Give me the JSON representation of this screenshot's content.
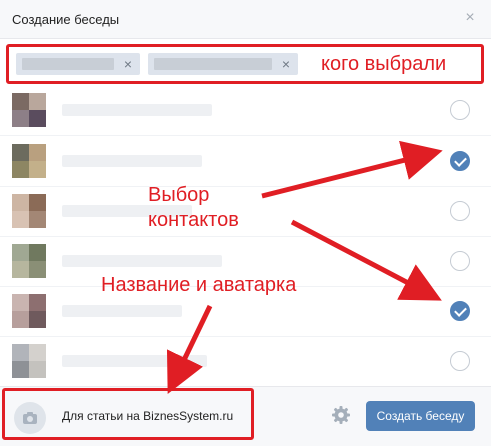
{
  "dialog": {
    "title": "Создание беседы",
    "close_icon": "×"
  },
  "selected": {
    "chips": [
      {
        "remove_icon": "×"
      },
      {
        "remove_icon": "×"
      }
    ]
  },
  "contacts": [
    {
      "checked": false,
      "avatar": [
        "#7b6a63",
        "#b9a79c",
        "#8d7f87",
        "#5a4c5e"
      ]
    },
    {
      "checked": true,
      "avatar": [
        "#6c6b5e",
        "#b9a07f",
        "#8d8663",
        "#c3b08a"
      ]
    },
    {
      "checked": false,
      "avatar": [
        "#cdb5a3",
        "#8b6b57",
        "#d8c2b3",
        "#a38775"
      ]
    },
    {
      "checked": false,
      "avatar": [
        "#a0a893",
        "#70795f",
        "#b6b69e",
        "#8a8f76"
      ]
    },
    {
      "checked": true,
      "avatar": [
        "#c9b4b0",
        "#8d6f70",
        "#b79f9c",
        "#6f5a5d"
      ]
    },
    {
      "checked": false,
      "avatar": [
        "#b1b4ba",
        "#d4d1cd",
        "#8e9196",
        "#c4c2be"
      ]
    }
  ],
  "footer": {
    "chat_name": "Для статьи на BiznesSystem.ru",
    "create_button": "Создать беседу",
    "camera_icon": "camera-icon",
    "settings_icon": "gear-icon"
  },
  "annotations": {
    "selected_label": "кого выбрали",
    "contacts_label_line1": "Выбор",
    "contacts_label_line2": "контактов",
    "name_label": "Название и аватарка"
  },
  "colors": {
    "accent": "#5181b8",
    "annotation_red": "#e01e24",
    "header_bg": "#f7f8fa"
  }
}
